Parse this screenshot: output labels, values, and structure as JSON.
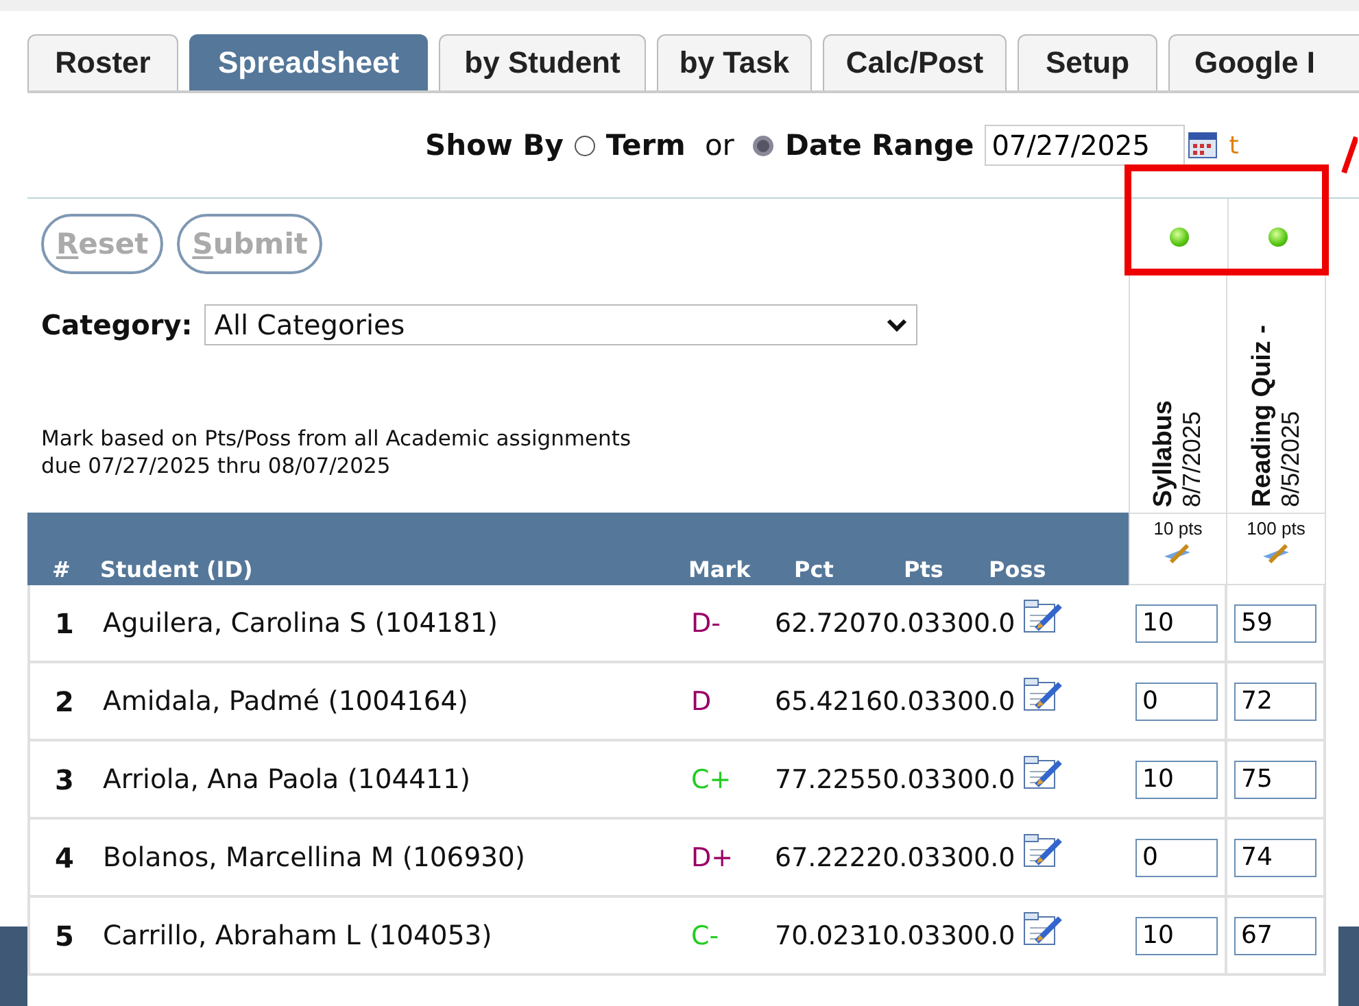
{
  "tabs": [
    {
      "label": "Roster",
      "selected": false
    },
    {
      "label": "Spreadsheet",
      "selected": true
    },
    {
      "label": "by Student",
      "selected": false
    },
    {
      "label": "by Task",
      "selected": false
    },
    {
      "label": "Calc/Post",
      "selected": false
    },
    {
      "label": "Setup",
      "selected": false
    },
    {
      "label": "Google I",
      "selected": false
    }
  ],
  "show_by": {
    "label": "Show By",
    "options": [
      {
        "label": "Term",
        "selected": false
      },
      {
        "label": "Date Range",
        "selected": true
      }
    ],
    "separator": "or",
    "date_from": "07/27/2025",
    "date_to_fragment": "t"
  },
  "buttons": [
    {
      "label": "Reset",
      "disabled": true
    },
    {
      "label": "Submit",
      "disabled": true
    }
  ],
  "category": {
    "label": "Category:",
    "value": "All Categories"
  },
  "note": [
    "Mark based on Pts/Poss from all Academic assignments",
    "due 07/27/2025 thru 08/07/2025"
  ],
  "table": {
    "columns": [
      "#",
      "Student (ID)",
      "Mark",
      "Pct",
      "Pts",
      "Poss"
    ],
    "assignments": [
      {
        "title": "Syllabus",
        "date": "8/7/2025",
        "points": "10 pts"
      },
      {
        "title": "Reading Quiz -",
        "date": "8/5/2025",
        "points": "100 pts"
      }
    ],
    "rows": [
      {
        "number": "1",
        "student": "Aguilera, Carolina S (104181)",
        "mark": "D-",
        "color": "#990066",
        "scores": "62.72070.03300.0",
        "entries": [
          "10",
          "59"
        ]
      },
      {
        "number": "2",
        "student": "Amidala, Padmé (1004164)",
        "mark": "D",
        "color": "#990066",
        "scores": "65.42160.03300.0",
        "entries": [
          "0",
          "72"
        ]
      },
      {
        "number": "3",
        "student": "Arriola, Ana Paola (104411)",
        "mark": "C+",
        "color": "#22cc22",
        "scores": "77.22550.03300.0",
        "entries": [
          "10",
          "75"
        ]
      },
      {
        "number": "4",
        "student": "Bolanos, Marcellina M (106930)",
        "mark": "D+",
        "color": "#990066",
        "scores": "67.22220.03300.0",
        "entries": [
          "0",
          "74"
        ]
      },
      {
        "number": "5",
        "student": "Carrillo, Abraham L (104053)",
        "mark": "C-",
        "color": "#22cc22",
        "scores": "70.02310.03300.0",
        "entries": [
          "10",
          "67"
        ]
      }
    ]
  }
}
